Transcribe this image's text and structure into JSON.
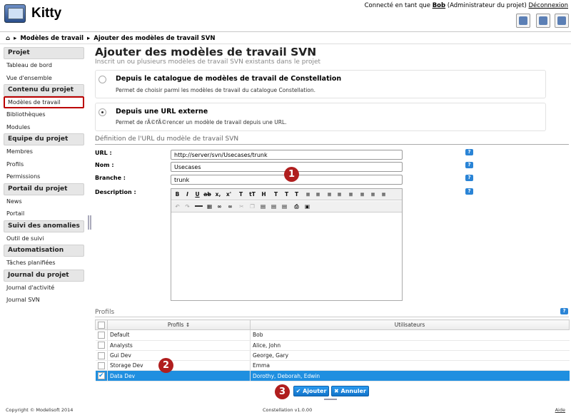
{
  "app": {
    "title": "Kitty"
  },
  "user": {
    "prefix": "Connecté en tant que",
    "name": "Bob",
    "role": "(Administrateur du projet)",
    "logout": "Déconnexion"
  },
  "breadcrumb": {
    "home_icon": "home-icon",
    "item1": "Modèles de travail",
    "item2": "Ajouter des modèles de travail SVN"
  },
  "sidebar": {
    "projet": {
      "header": "Projet",
      "items": [
        "Tableau de bord",
        "Vue d'ensemble"
      ]
    },
    "contenu": {
      "header": "Contenu du projet",
      "items": [
        "Modèles de travail",
        "Bibliothèques",
        "Modules"
      ]
    },
    "equipe": {
      "header": "Equipe du projet",
      "items": [
        "Membres",
        "Profils",
        "Permissions"
      ]
    },
    "portail": {
      "header": "Portail du projet",
      "items": [
        "News",
        "Portail"
      ]
    },
    "suivi": {
      "header": "Suivi des anomalies",
      "items": [
        "Outil de suivi"
      ]
    },
    "auto": {
      "header": "Automatisation",
      "items": [
        "Tâches planifiées"
      ]
    },
    "journal": {
      "header": "Journal du projet",
      "items": [
        "Journal d'activité",
        "Journal SVN"
      ]
    }
  },
  "main": {
    "title": "Ajouter des modèles de travail SVN",
    "subtitle": "Inscrit un ou plusieurs modèles de travail SVN existants dans le projet",
    "source1": {
      "title": "Depuis le catalogue de modèles de travail de Constellation",
      "desc": "Permet de choisir parmi les modèles de travail du catalogue Constellation.",
      "selected": false
    },
    "source2": {
      "title": "Depuis une URL externe",
      "desc": "Permet de rÃ©fÃ©rencer un modèle de travail depuis une URL.",
      "selected": true
    },
    "definition_legend": "Définition de l'URL du modèle de travail SVN",
    "fields": {
      "url": {
        "label": "URL :",
        "value": "http://server/svn/Usecases/trunk"
      },
      "nom": {
        "label": "Nom :",
        "value": "Usecases"
      },
      "branche": {
        "label": "Branche :",
        "value": "trunk"
      },
      "description": {
        "label": "Description :"
      }
    },
    "help": "?",
    "profils_legend": "Profils",
    "table": {
      "headers": [
        "Profils ⇕",
        "Utilisateurs"
      ],
      "rows": [
        {
          "profil": "Default",
          "users": "Bob",
          "checked": false
        },
        {
          "profil": "Analysts",
          "users": "Alice, John",
          "checked": false
        },
        {
          "profil": "Gui Dev",
          "users": "George, Gary",
          "checked": false
        },
        {
          "profil": "Storage Dev",
          "users": "Emma",
          "checked": false
        },
        {
          "profil": "Data Dev",
          "users": "Dorothy, Deborah, Edwin",
          "checked": true
        }
      ]
    },
    "buttons": {
      "add": "✔ Ajouter",
      "cancel": "✖ Annuler"
    },
    "markers": [
      "1",
      "2",
      "3"
    ]
  },
  "footer": {
    "copyright": "Copyright © Modelisoft 2014",
    "version": "Constellation v1.0.00",
    "help": "Aide"
  },
  "colors": {
    "selection": "#1f8fe0",
    "marker": "#b01e1e",
    "button": "#1273c9"
  }
}
